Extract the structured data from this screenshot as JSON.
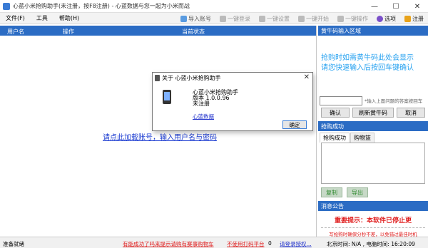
{
  "window": {
    "title": "心蓝小米抢购助手(未注册，按F8注册) - 心蓝数据与您一起为小米而战",
    "minimize_glyph": "—",
    "maximize_glyph": "☐",
    "close_glyph": "✕"
  },
  "menu": [
    "文件(F)",
    "工具",
    "帮助(H)"
  ],
  "toolbar": [
    {
      "label": "导入账号",
      "icon": "import-icon",
      "enabled": true
    },
    {
      "label": "一键登录",
      "icon": "login-icon",
      "enabled": false
    },
    {
      "label": "一键设置",
      "icon": "settings-icon",
      "enabled": false
    },
    {
      "label": "一键开始",
      "icon": "start-icon",
      "enabled": false
    },
    {
      "label": "一键操作",
      "icon": "operate-icon",
      "enabled": false
    },
    {
      "label": "选项",
      "icon": "options-icon",
      "enabled": true
    },
    {
      "label": "注册",
      "icon": "register-icon",
      "enabled": true
    }
  ],
  "grid": {
    "columns": [
      "用户名",
      "操作",
      "当前状态"
    ],
    "empty_link": "请点此加载账号，输入用户名与密码"
  },
  "captcha": {
    "header": "黄牛码输入区域",
    "hint_lines": [
      "抢购时如需黄牛码此处会显示",
      "请您快速输入后按回车键确认"
    ],
    "input_value": "",
    "input_hint": "*输入上面问题的答案按回车",
    "buttons": [
      "确认",
      "刷新黄牛码",
      "取消"
    ]
  },
  "success": {
    "header": "抢购成功",
    "tabs": [
      "抢购成功",
      "购物篮"
    ],
    "buttons": [
      "复制",
      "导出"
    ]
  },
  "announcement": {
    "header": "消息公告",
    "notice": "重要提示：本软件已停止更",
    "sub_notice": "写抢购时确保分秒不差，以免错过最佳时机"
  },
  "dialog": {
    "title": "关于 心蓝小米抢购助手",
    "close_glyph": "✕",
    "app_name": "心蓝小米抢购助手",
    "version": "版本 1.0.0.96",
    "register_status": "未注册",
    "link": "心蓝数据",
    "ok_label": "确定"
  },
  "status": {
    "ready": "准备就绪",
    "link1": "有能成功了吗来提示请购有赛事购物车",
    "link2": "不使用打码平台",
    "counter": "0",
    "login_link": "请登录授权...",
    "beijing_time": "北京时间: N/A , 电脑时间: 16:20:09"
  },
  "colors": {
    "header_blue": "#2b6cc4",
    "captcha_text": "#2aa3f0",
    "notice_red": "#e02020",
    "link_blue": "#1c3cd1"
  }
}
